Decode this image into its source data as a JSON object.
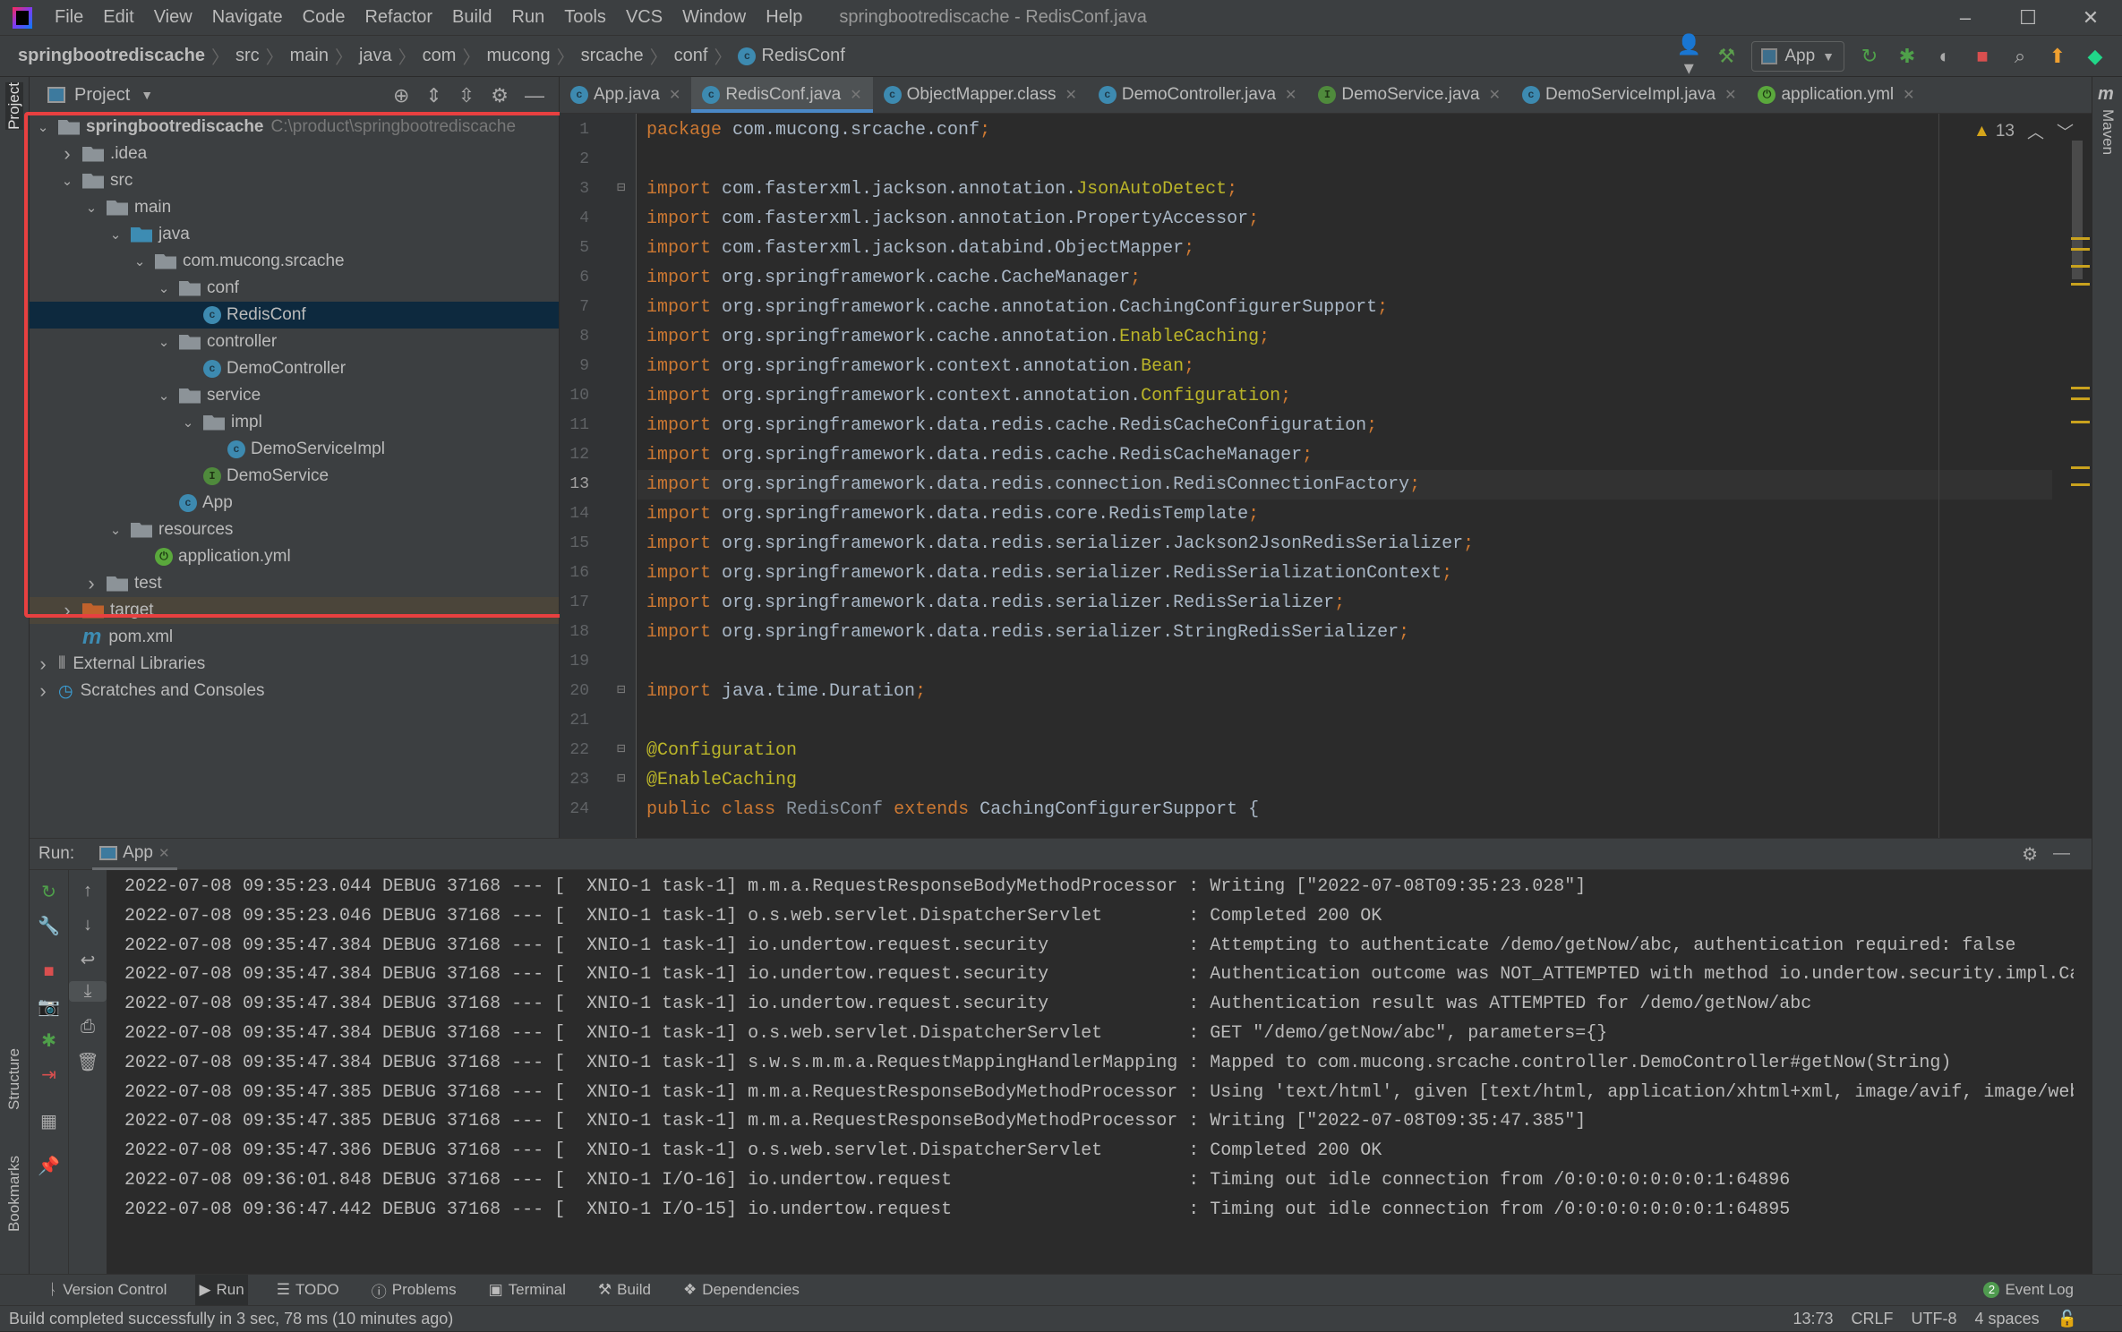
{
  "window": {
    "title": "springbootrediscache - RedisConf.java",
    "minimize": "–",
    "maximize": "☐",
    "close": "✕"
  },
  "menu": [
    "File",
    "Edit",
    "View",
    "Navigate",
    "Code",
    "Refactor",
    "Build",
    "Run",
    "Tools",
    "VCS",
    "Window",
    "Help"
  ],
  "breadcrumb": [
    "springbootrediscache",
    "src",
    "main",
    "java",
    "com",
    "mucong",
    "srcache",
    "conf",
    "RedisConf"
  ],
  "toolbar": {
    "run_config": "App"
  },
  "left_stripe": {
    "project": "Project",
    "structure": "Structure",
    "bookmarks": "Bookmarks"
  },
  "right_stripe": {
    "maven": "Maven"
  },
  "project_panel": {
    "title": "Project",
    "tree": [
      {
        "depth": 0,
        "chevron": "down",
        "icon": "module-folder",
        "label": "springbootrediscache",
        "hint": "C:\\product\\springbootrediscache",
        "bold": true
      },
      {
        "depth": 1,
        "chevron": "right",
        "icon": "folder",
        "label": ".idea"
      },
      {
        "depth": 1,
        "chevron": "down",
        "icon": "folder",
        "label": "src"
      },
      {
        "depth": 2,
        "chevron": "down",
        "icon": "folder",
        "label": "main"
      },
      {
        "depth": 3,
        "chevron": "down",
        "icon": "source-folder",
        "label": "java"
      },
      {
        "depth": 4,
        "chevron": "down",
        "icon": "package",
        "label": "com.mucong.srcache"
      },
      {
        "depth": 5,
        "chevron": "down",
        "icon": "package",
        "label": "conf"
      },
      {
        "depth": 6,
        "chevron": "",
        "icon": "class",
        "label": "RedisConf",
        "selected": true
      },
      {
        "depth": 5,
        "chevron": "down",
        "icon": "package",
        "label": "controller"
      },
      {
        "depth": 6,
        "chevron": "",
        "icon": "class",
        "label": "DemoController"
      },
      {
        "depth": 5,
        "chevron": "down",
        "icon": "package",
        "label": "service"
      },
      {
        "depth": 6,
        "chevron": "down",
        "icon": "package",
        "label": "impl"
      },
      {
        "depth": 7,
        "chevron": "",
        "icon": "class",
        "label": "DemoServiceImpl"
      },
      {
        "depth": 6,
        "chevron": "",
        "icon": "interface",
        "label": "DemoService"
      },
      {
        "depth": 5,
        "chevron": "",
        "icon": "class-runnable",
        "label": "App"
      },
      {
        "depth": 3,
        "chevron": "down",
        "icon": "resources-folder",
        "label": "resources"
      },
      {
        "depth": 4,
        "chevron": "",
        "icon": "spring-yml",
        "label": "application.yml"
      },
      {
        "depth": 2,
        "chevron": "right",
        "icon": "folder",
        "label": "test"
      },
      {
        "depth": 1,
        "chevron": "right",
        "icon": "excluded-folder",
        "label": "target",
        "excluded": true
      },
      {
        "depth": 1,
        "chevron": "",
        "icon": "maven",
        "label": "pom.xml"
      },
      {
        "depth": 0,
        "chevron": "right",
        "icon": "libraries",
        "label": "External Libraries"
      },
      {
        "depth": 0,
        "chevron": "right",
        "icon": "scratches",
        "label": "Scratches and Consoles"
      }
    ]
  },
  "tabs": [
    {
      "label": "App.java",
      "icon": "class-runnable"
    },
    {
      "label": "RedisConf.java",
      "icon": "class",
      "active": true
    },
    {
      "label": "ObjectMapper.class",
      "icon": "class"
    },
    {
      "label": "DemoController.java",
      "icon": "class"
    },
    {
      "label": "DemoService.java",
      "icon": "interface"
    },
    {
      "label": "DemoServiceImpl.java",
      "icon": "class"
    },
    {
      "label": "application.yml",
      "icon": "spring-yml"
    }
  ],
  "editor": {
    "warnings_count": "13",
    "current_line": 13,
    "lines": [
      [
        [
          "kw",
          "package"
        ],
        [
          "tx",
          " com.mucong.srcache.conf"
        ],
        [
          "kw",
          ";"
        ]
      ],
      [],
      [
        [
          "kw",
          "import"
        ],
        [
          "tx",
          " com.fasterxml.jackson.annotation."
        ],
        [
          "an",
          "JsonAutoDetect"
        ],
        [
          "kw",
          ";"
        ]
      ],
      [
        [
          "kw",
          "import"
        ],
        [
          "tx",
          " com.fasterxml.jackson.annotation.PropertyAccessor"
        ],
        [
          "kw",
          ";"
        ]
      ],
      [
        [
          "kw",
          "import"
        ],
        [
          "tx",
          " com.fasterxml.jackson.databind.ObjectMapper"
        ],
        [
          "kw",
          ";"
        ]
      ],
      [
        [
          "kw",
          "import"
        ],
        [
          "tx",
          " org.springframework.cache.CacheManager"
        ],
        [
          "kw",
          ";"
        ]
      ],
      [
        [
          "kw",
          "import"
        ],
        [
          "tx",
          " org.springframework.cache.annotation.CachingConfigurerSupport"
        ],
        [
          "kw",
          ";"
        ]
      ],
      [
        [
          "kw",
          "import"
        ],
        [
          "tx",
          " org.springframework.cache.annotation."
        ],
        [
          "an",
          "EnableCaching"
        ],
        [
          "kw",
          ";"
        ]
      ],
      [
        [
          "kw",
          "import"
        ],
        [
          "tx",
          " org.springframework.context.annotation."
        ],
        [
          "an",
          "Bean"
        ],
        [
          "kw",
          ";"
        ]
      ],
      [
        [
          "kw",
          "import"
        ],
        [
          "tx",
          " org.springframework.context.annotation."
        ],
        [
          "an",
          "Configuration"
        ],
        [
          "kw",
          ";"
        ]
      ],
      [
        [
          "kw",
          "import"
        ],
        [
          "tx",
          " org.springframework.data.redis.cache.RedisCacheConfiguration"
        ],
        [
          "kw",
          ";"
        ]
      ],
      [
        [
          "kw",
          "import"
        ],
        [
          "tx",
          " org.springframework.data.redis.cache.RedisCacheManager"
        ],
        [
          "kw",
          ";"
        ]
      ],
      [
        [
          "kw",
          "import"
        ],
        [
          "tx",
          " org.springframework.data.redis.connection.RedisConnectionFactory"
        ],
        [
          "kw",
          ";"
        ]
      ],
      [
        [
          "kw",
          "import"
        ],
        [
          "tx",
          " org.springframework.data.redis.core.RedisTemplate"
        ],
        [
          "kw",
          ";"
        ]
      ],
      [
        [
          "kw",
          "import"
        ],
        [
          "tx",
          " org.springframework.data.redis.serializer.Jackson2JsonRedisSerializer"
        ],
        [
          "kw",
          ";"
        ]
      ],
      [
        [
          "kw",
          "import"
        ],
        [
          "tx",
          " org.springframework.data.redis.serializer.RedisSerializationContext"
        ],
        [
          "kw",
          ";"
        ]
      ],
      [
        [
          "kw",
          "import"
        ],
        [
          "tx",
          " org.springframework.data.redis.serializer.RedisSerializer"
        ],
        [
          "kw",
          ";"
        ]
      ],
      [
        [
          "kw",
          "import"
        ],
        [
          "tx",
          " org.springframework.data.redis.serializer.StringRedisSerializer"
        ],
        [
          "kw",
          ";"
        ]
      ],
      [],
      [
        [
          "kw",
          "import"
        ],
        [
          "tx",
          " java.time.Duration"
        ],
        [
          "kw",
          ";"
        ]
      ],
      [],
      [
        [
          "an",
          "@Configuration"
        ]
      ],
      [
        [
          "an",
          "@EnableCaching"
        ]
      ],
      [
        [
          "kw",
          "public class "
        ],
        [
          "gr",
          "RedisConf "
        ],
        [
          "kw",
          "extends "
        ],
        [
          "tx",
          "CachingConfigurerSupport {"
        ]
      ]
    ]
  },
  "run_panel": {
    "label": "Run:",
    "tab": "App",
    "log": [
      "2022-07-08 09:35:23.044 DEBUG 37168 --- [  XNIO-1 task-1] m.m.a.RequestResponseBodyMethodProcessor : Writing [\"2022-07-08T09:35:23.028\"]",
      "2022-07-08 09:35:23.046 DEBUG 37168 --- [  XNIO-1 task-1] o.s.web.servlet.DispatcherServlet        : Completed 200 OK",
      "2022-07-08 09:35:47.384 DEBUG 37168 --- [  XNIO-1 task-1] io.undertow.request.security             : Attempting to authenticate /demo/getNow/abc, authentication required: false",
      "2022-07-08 09:35:47.384 DEBUG 37168 --- [  XNIO-1 task-1] io.undertow.request.security             : Authentication outcome was NOT_ATTEMPTED with method io.undertow.security.impl.Cac",
      "2022-07-08 09:35:47.384 DEBUG 37168 --- [  XNIO-1 task-1] io.undertow.request.security             : Authentication result was ATTEMPTED for /demo/getNow/abc",
      "2022-07-08 09:35:47.384 DEBUG 37168 --- [  XNIO-1 task-1] o.s.web.servlet.DispatcherServlet        : GET \"/demo/getNow/abc\", parameters={}",
      "2022-07-08 09:35:47.384 DEBUG 37168 --- [  XNIO-1 task-1] s.w.s.m.m.a.RequestMappingHandlerMapping : Mapped to com.mucong.srcache.controller.DemoController#getNow(String)",
      "2022-07-08 09:35:47.385 DEBUG 37168 --- [  XNIO-1 task-1] m.m.a.RequestResponseBodyMethodProcessor : Using 'text/html', given [text/html, application/xhtml+xml, image/avif, image/webp",
      "2022-07-08 09:35:47.385 DEBUG 37168 --- [  XNIO-1 task-1] m.m.a.RequestResponseBodyMethodProcessor : Writing [\"2022-07-08T09:35:47.385\"]",
      "2022-07-08 09:35:47.386 DEBUG 37168 --- [  XNIO-1 task-1] o.s.web.servlet.DispatcherServlet        : Completed 200 OK",
      "2022-07-08 09:36:01.848 DEBUG 37168 --- [  XNIO-1 I/O-16] io.undertow.request                      : Timing out idle connection from /0:0:0:0:0:0:0:1:64896",
      "2022-07-08 09:36:47.442 DEBUG 37168 --- [  XNIO-1 I/O-15] io.undertow.request                      : Timing out idle connection from /0:0:0:0:0:0:0:1:64895"
    ]
  },
  "bottom_tools": [
    {
      "label": "Version Control",
      "icon": "branch-icon"
    },
    {
      "label": "Run",
      "icon": "run-icon",
      "active": true
    },
    {
      "label": "TODO",
      "icon": "list-icon"
    },
    {
      "label": "Problems",
      "icon": "problems-icon"
    },
    {
      "label": "Terminal",
      "icon": "terminal-icon"
    },
    {
      "label": "Build",
      "icon": "hammer-icon"
    },
    {
      "label": "Dependencies",
      "icon": "dependencies-icon"
    }
  ],
  "event_log": {
    "label": "Event Log",
    "count": "2"
  },
  "status": {
    "message": "Build completed successfully in 3 sec, 78 ms (10 minutes ago)",
    "position": "13:73",
    "line_sep": "CRLF",
    "encoding": "UTF-8",
    "indent": "4 spaces"
  },
  "colors": {
    "accent": "#4a88c7",
    "keyword": "#cc7832",
    "annotation": "#bbb529",
    "text": "#a9b7c6",
    "selection": "#0d293e",
    "highlight_box": "#e84040"
  }
}
